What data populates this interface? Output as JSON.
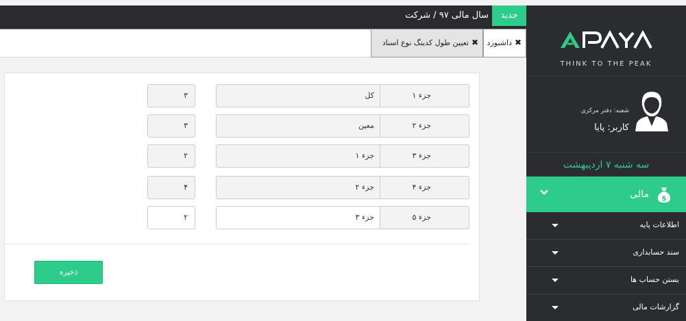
{
  "header": {
    "fiscal_year": "سال مالی ۹۷ / شرکت",
    "new_badge": "جدید"
  },
  "tabs": {
    "dashboard": "داشبورد",
    "active": "تعیین طول کدینگ نوع اسناد",
    "close_glyph": "✖"
  },
  "sidebar": {
    "logo_tagline": "THINK TO THE PEAK",
    "branch": "شعبه: دفتر مرکزی",
    "user": "کاربر: پایا",
    "date": "سه شنبه ۷ اردیبهشت",
    "menu_main": "مالی",
    "menu_items": [
      {
        "label": "اطلاعات پایه"
      },
      {
        "label": "سند حسابداری"
      },
      {
        "label": "بستن حساب ها"
      },
      {
        "label": "گزارشات مالی"
      }
    ]
  },
  "form": {
    "rows": [
      {
        "part": "جزء ۱",
        "name": "کل",
        "length": "۳"
      },
      {
        "part": "جزء ۲",
        "name": "معین",
        "length": "۳"
      },
      {
        "part": "جزء ۳",
        "name": "جزء ۱",
        "length": "۲"
      },
      {
        "part": "جزء ۴",
        "name": "جزء ۲",
        "length": "۴"
      },
      {
        "part": "جزء ۵",
        "name": "جزء ۳",
        "length": "۲"
      }
    ],
    "save_label": "ذخیره"
  },
  "colors": {
    "accent": "#2ecc8b",
    "sidebar_bg": "#2b2c30",
    "topbar_bg": "#2a2b2f"
  }
}
